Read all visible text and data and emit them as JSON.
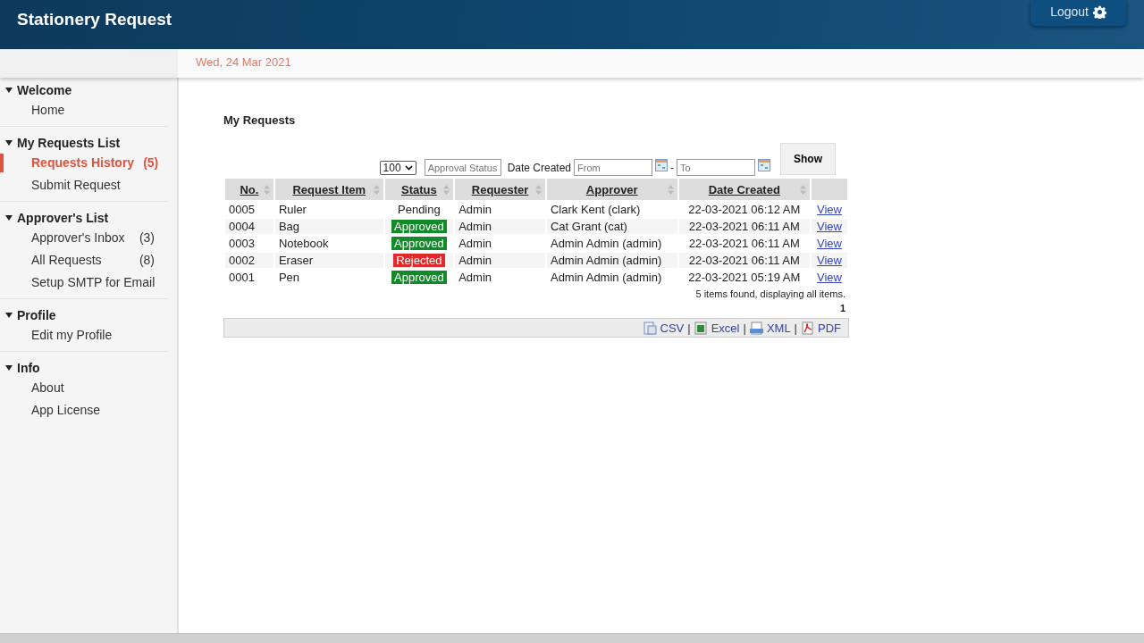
{
  "header": {
    "title": "Stationery Request",
    "logout": "Logout"
  },
  "date": "Wed, 24 Mar 2021",
  "sidebar": [
    {
      "title": "Welcome",
      "expanded": true,
      "items": [
        {
          "label": "Home",
          "selected": false
        }
      ]
    },
    {
      "title": "My Requests List",
      "expanded": true,
      "items": [
        {
          "label": "Requests History",
          "count": "(5)",
          "selected": true
        },
        {
          "label": "Submit Request",
          "selected": false
        }
      ]
    },
    {
      "title": "Approver's List",
      "expanded": true,
      "items": [
        {
          "label": "Approver's Inbox",
          "count": "(3)",
          "selected": false
        },
        {
          "label": "All Requests",
          "count": "(8)",
          "selected": false
        },
        {
          "label": "Setup SMTP for Email",
          "selected": false
        }
      ]
    },
    {
      "title": "Profile",
      "expanded": true,
      "items": [
        {
          "label": "Edit my Profile",
          "selected": false
        }
      ]
    },
    {
      "title": "Info",
      "expanded": true,
      "items": [
        {
          "label": "About",
          "selected": false
        },
        {
          "label": "App License",
          "selected": false
        }
      ]
    }
  ],
  "page_title": "My Requests",
  "filters": {
    "page_size": "100",
    "status_placeholder": "Approval Status",
    "date_label": "Date Created",
    "from_placeholder": "From",
    "dash": "-",
    "to_placeholder": "To",
    "show": "Show"
  },
  "table": {
    "columns": [
      "No.",
      "Request Item",
      "Status",
      "Requester",
      "Approver",
      "Date Created"
    ],
    "rows": [
      {
        "no": "0005",
        "item": "Ruler",
        "status": "Pending",
        "kind": "pending",
        "requester": "Admin",
        "approver": "Clark Kent (clark)",
        "date": "22-03-2021 06:12 AM",
        "link": "View"
      },
      {
        "no": "0004",
        "item": "Bag",
        "status": "Approved",
        "kind": "approved",
        "requester": "Admin",
        "approver": "Cat Grant (cat)",
        "date": "22-03-2021 06:11 AM",
        "link": "View"
      },
      {
        "no": "0003",
        "item": "Notebook",
        "status": "Approved",
        "kind": "approved",
        "requester": "Admin",
        "approver": "Admin Admin (admin)",
        "date": "22-03-2021 06:11 AM",
        "link": "View"
      },
      {
        "no": "0002",
        "item": "Eraser",
        "status": "Rejected",
        "kind": "rejected",
        "requester": "Admin",
        "approver": "Admin Admin (admin)",
        "date": "22-03-2021 06:11 AM",
        "link": "View"
      },
      {
        "no": "0001",
        "item": "Pen",
        "status": "Approved",
        "kind": "approved",
        "requester": "Admin",
        "approver": "Admin Admin (admin)",
        "date": "22-03-2021 05:19 AM",
        "link": "View"
      }
    ],
    "summary": "5 items found, displaying all items.",
    "page": "1"
  },
  "exports": [
    {
      "label": "CSV",
      "kind": "csv"
    },
    {
      "label": "Excel",
      "kind": "excel"
    },
    {
      "label": "XML",
      "kind": "xml"
    },
    {
      "label": "PDF",
      "kind": "pdf"
    }
  ],
  "export_separator": "|"
}
